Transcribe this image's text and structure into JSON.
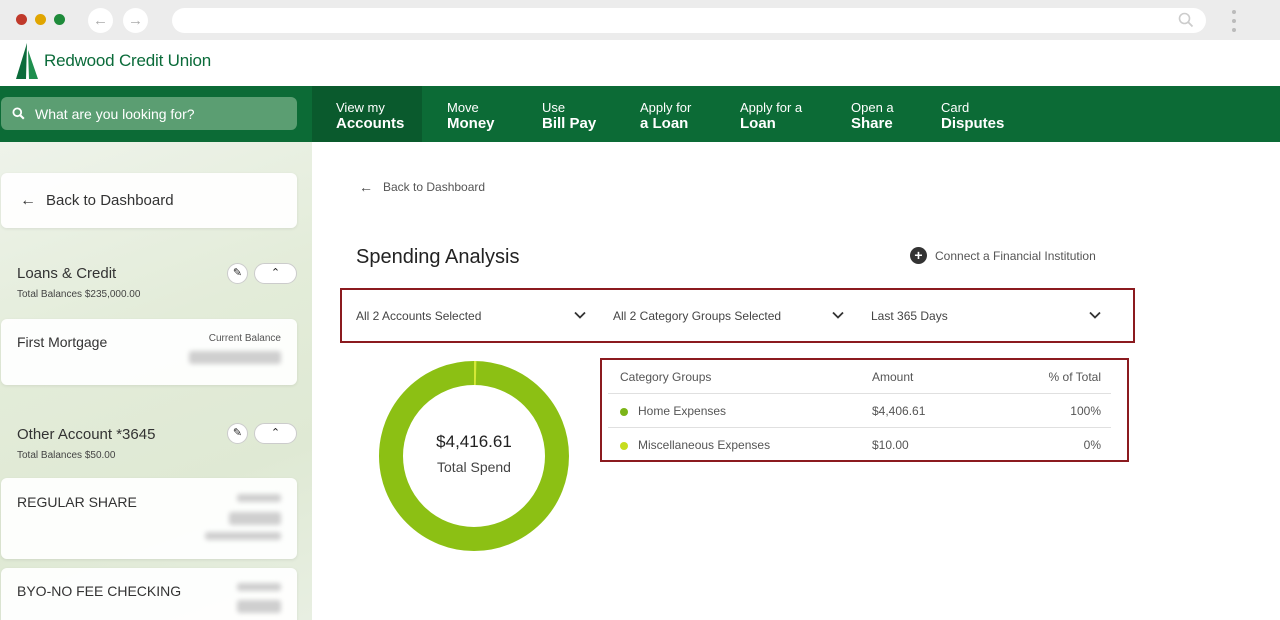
{
  "search": {
    "placeholder": "What are you looking for?"
  },
  "brand": {
    "name": "Redwood Credit Union",
    "color": "#0c6b36"
  },
  "nav": [
    {
      "line1": "View my",
      "line2": "Accounts",
      "active": true
    },
    {
      "line1": "Move",
      "line2": "Money"
    },
    {
      "line1": "Use",
      "line2": "Bill Pay"
    },
    {
      "line1": "Apply for",
      "line2": "a Loan"
    },
    {
      "line1": "Apply for a",
      "line2": "Loan"
    },
    {
      "line1": "Open a",
      "line2": "Share"
    },
    {
      "line1": "Card",
      "line2": "Disputes"
    }
  ],
  "sidebar": {
    "back_label": "Back to Dashboard",
    "groups": [
      {
        "title": "Loans & Credit",
        "subtitle": "Total Balances $235,000.00",
        "accounts": [
          {
            "name": "First Mortgage",
            "label": "Current Balance"
          }
        ]
      },
      {
        "title": "Other Account *3645",
        "subtitle": "Total Balances $50.00",
        "accounts": [
          {
            "name": "REGULAR SHARE"
          },
          {
            "name": "BYO-NO FEE CHECKING"
          }
        ]
      }
    ]
  },
  "main": {
    "back_label": "Back to Dashboard",
    "title": "Spending Analysis",
    "connect_label": "Connect a Financial Institution",
    "filters": {
      "accounts": "All 2 Accounts Selected",
      "categories": "All 2 Category Groups Selected",
      "period": "Last 365 Days"
    },
    "summary": {
      "amount": "$4,416.61",
      "label": "Total Spend"
    },
    "table": {
      "headers": [
        "Category Groups",
        "Amount",
        "% of Total"
      ],
      "rows": [
        {
          "name": "Home Expenses",
          "amount": "$4,406.61",
          "pct": "100%",
          "color": "#7cb518"
        },
        {
          "name": "Miscellaneous Expenses",
          "amount": "$10.00",
          "pct": "0%",
          "color": "#c6dd1f"
        }
      ]
    },
    "donut": {
      "values": [
        4406.61,
        10.0
      ],
      "colors": [
        "#8cc014",
        "#d4e836"
      ]
    }
  }
}
